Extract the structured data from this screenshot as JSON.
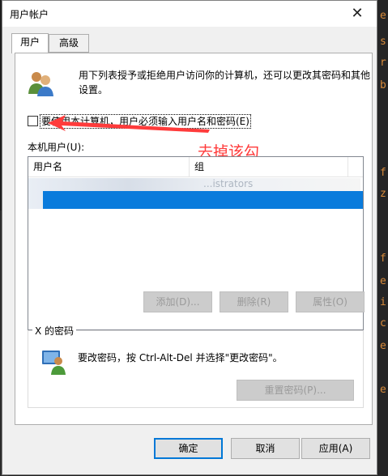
{
  "window": {
    "title": "用户帐户",
    "close_glyph": "✕"
  },
  "tabs": [
    {
      "label": "用户"
    },
    {
      "label": "高级"
    }
  ],
  "description": "用下列表授予或拒绝用户访问你的计算机，还可以更改其密码和其他设置。",
  "require_password_checkbox": {
    "label": "要使用本计算机，用户必须输入用户名和密码(E)",
    "checked": false
  },
  "annotation": {
    "text": "去掉该勾",
    "color": "#ff3b3b"
  },
  "users_label": "本机用户(U):",
  "users_table": {
    "columns": [
      "用户名",
      "组"
    ],
    "rows": [
      {
        "username": "",
        "group": "...istrators"
      }
    ]
  },
  "user_buttons": {
    "add": "添加(D)...",
    "remove": "删除(R)",
    "properties": "属性(O)"
  },
  "password_group": {
    "title": "X 的密码",
    "text": "要改密码，按 Ctrl-Alt-Del 并选择\"更改密码\"。",
    "reset_button": "重置密码(P)..."
  },
  "footer_buttons": {
    "ok": "确定",
    "cancel": "取消",
    "apply": "应用(A)"
  },
  "accent_color": "#0078d7"
}
